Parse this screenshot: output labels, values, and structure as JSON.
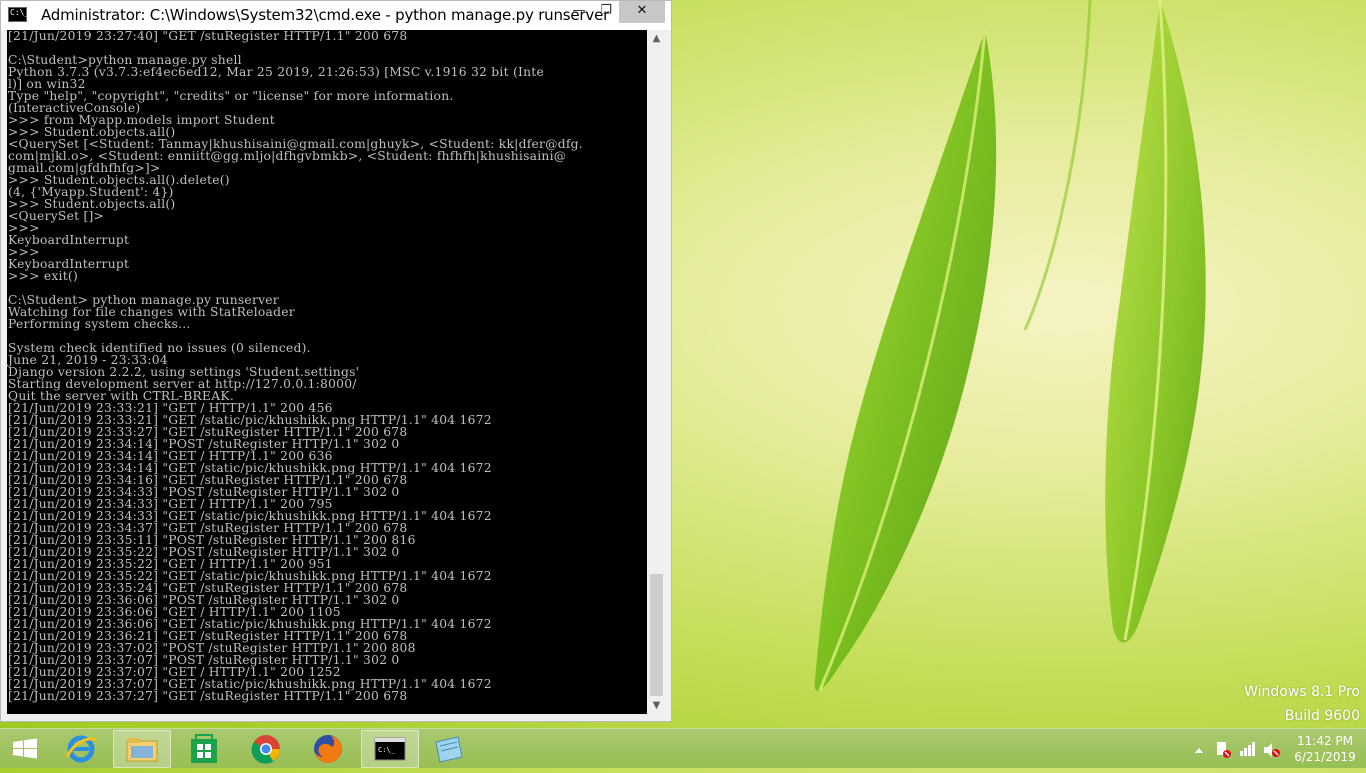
{
  "window": {
    "title": "Administrator: C:\\Windows\\System32\\cmd.exe - python  manage.py runserver",
    "icon_label": "C:\\_",
    "controls": {
      "minimize": "—",
      "maximize": "❐",
      "close": "✕"
    }
  },
  "console": {
    "lines": [
      "[21/Jun/2019 23:27:40] \"GET /stuRegister HTTP/1.1\" 200 678",
      "",
      "C:\\Student>python manage.py shell",
      "Python 3.7.3 (v3.7.3:ef4ec6ed12, Mar 25 2019, 21:26:53) [MSC v.1916 32 bit (Inte",
      "l)] on win32",
      "Type \"help\", \"copyright\", \"credits\" or \"license\" for more information.",
      "(InteractiveConsole)",
      ">>> from Myapp.models import Student",
      ">>> Student.objects.all()",
      "<QuerySet [<Student: Tanmay|khushisaini@gmail.com|ghuyk>, <Student: kk|dfer@dfg.",
      "com|mjkl.o>, <Student: enniitt@gg.mljo|dfhgvbmkb>, <Student: fhfhfh|khushisaini@",
      "gmail.com|gfdhfhfg>]>",
      ">>> Student.objects.all().delete()",
      "(4, {'Myapp.Student': 4})",
      ">>> Student.objects.all()",
      "<QuerySet []>",
      ">>>",
      "KeyboardInterrupt",
      ">>>",
      "KeyboardInterrupt",
      ">>> exit()",
      "",
      "C:\\Student> python manage.py runserver",
      "Watching for file changes with StatReloader",
      "Performing system checks...",
      "",
      "System check identified no issues (0 silenced).",
      "June 21, 2019 - 23:33:04",
      "Django version 2.2.2, using settings 'Student.settings'",
      "Starting development server at http://127.0.0.1:8000/",
      "Quit the server with CTRL-BREAK.",
      "[21/Jun/2019 23:33:21] \"GET / HTTP/1.1\" 200 456",
      "[21/Jun/2019 23:33:21] \"GET /static/pic/khushikk.png HTTP/1.1\" 404 1672",
      "[21/Jun/2019 23:33:27] \"GET /stuRegister HTTP/1.1\" 200 678",
      "[21/Jun/2019 23:34:14] \"POST /stuRegister HTTP/1.1\" 302 0",
      "[21/Jun/2019 23:34:14] \"GET / HTTP/1.1\" 200 636",
      "[21/Jun/2019 23:34:14] \"GET /static/pic/khushikk.png HTTP/1.1\" 404 1672",
      "[21/Jun/2019 23:34:16] \"GET /stuRegister HTTP/1.1\" 200 678",
      "[21/Jun/2019 23:34:33] \"POST /stuRegister HTTP/1.1\" 302 0",
      "[21/Jun/2019 23:34:33] \"GET / HTTP/1.1\" 200 795",
      "[21/Jun/2019 23:34:33] \"GET /static/pic/khushikk.png HTTP/1.1\" 404 1672",
      "[21/Jun/2019 23:34:37] \"GET /stuRegister HTTP/1.1\" 200 678",
      "[21/Jun/2019 23:35:11] \"POST /stuRegister HTTP/1.1\" 200 816",
      "[21/Jun/2019 23:35:22] \"POST /stuRegister HTTP/1.1\" 302 0",
      "[21/Jun/2019 23:35:22] \"GET / HTTP/1.1\" 200 951",
      "[21/Jun/2019 23:35:22] \"GET /static/pic/khushikk.png HTTP/1.1\" 404 1672",
      "[21/Jun/2019 23:35:24] \"GET /stuRegister HTTP/1.1\" 200 678",
      "[21/Jun/2019 23:36:06] \"POST /stuRegister HTTP/1.1\" 302 0",
      "[21/Jun/2019 23:36:06] \"GET / HTTP/1.1\" 200 1105",
      "[21/Jun/2019 23:36:06] \"GET /static/pic/khushikk.png HTTP/1.1\" 404 1672",
      "[21/Jun/2019 23:36:21] \"GET /stuRegister HTTP/1.1\" 200 678",
      "[21/Jun/2019 23:37:02] \"POST /stuRegister HTTP/1.1\" 200 808",
      "[21/Jun/2019 23:37:07] \"POST /stuRegister HTTP/1.1\" 302 0",
      "[21/Jun/2019 23:37:07] \"GET / HTTP/1.1\" 200 1252",
      "[21/Jun/2019 23:37:07] \"GET /static/pic/khushikk.png HTTP/1.1\" 404 1672",
      "[21/Jun/2019 23:37:27] \"GET /stuRegister HTTP/1.1\" 200 678"
    ]
  },
  "desktop": {
    "edition": "Windows 8.1 Pro",
    "build": "Build 9600"
  },
  "taskbar": {
    "pinned": [
      {
        "name": "internet-explorer",
        "icon": "ie-icon"
      },
      {
        "name": "file-explorer",
        "icon": "folder-icon"
      },
      {
        "name": "store",
        "icon": "store-icon"
      },
      {
        "name": "chrome",
        "icon": "chrome-icon"
      },
      {
        "name": "firefox",
        "icon": "firefox-icon"
      },
      {
        "name": "command-prompt",
        "icon": "cmd-icon",
        "label": "C:\\_"
      },
      {
        "name": "notepad",
        "icon": "notepad-icon"
      }
    ],
    "clock": {
      "time": "11:42 PM",
      "date": "6/21/2019"
    }
  }
}
